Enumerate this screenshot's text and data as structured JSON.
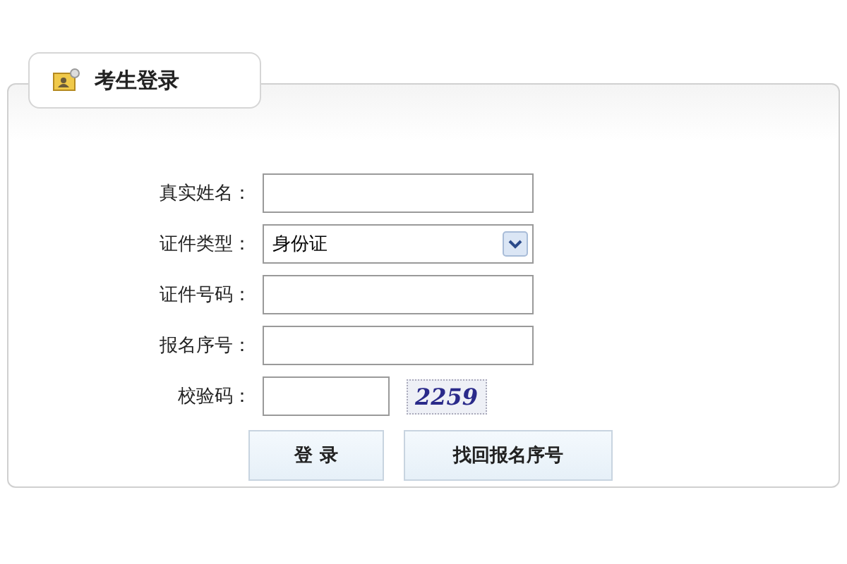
{
  "panel": {
    "title": "考生登录"
  },
  "fields": [
    {
      "kind": "text",
      "label": "真实姓名："
    },
    {
      "kind": "select",
      "label": "证件类型：",
      "value": "身份证"
    },
    {
      "kind": "text",
      "label": "证件号码："
    },
    {
      "kind": "text",
      "label": "报名序号："
    },
    {
      "kind": "captcha",
      "label": "校验码：",
      "captcha": "2259"
    }
  ],
  "buttons": [
    "登 录",
    "找回报名序号"
  ]
}
